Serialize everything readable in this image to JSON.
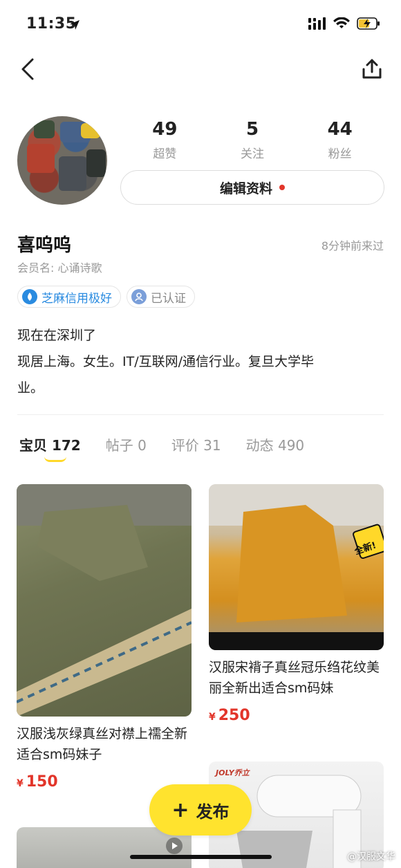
{
  "status": {
    "time": "11:35"
  },
  "profile": {
    "stats": [
      {
        "num": "49",
        "label": "超赞"
      },
      {
        "num": "5",
        "label": "关注"
      },
      {
        "num": "44",
        "label": "粉丝"
      }
    ],
    "edit_label": "编辑资料",
    "name": "喜呜呜",
    "last_seen": "8分钟前来过",
    "member": "会员名: 心诵诗歌",
    "badges": {
      "credit": "芝麻信用极好",
      "verified": "已认证"
    },
    "bio": [
      "现在在深圳了",
      "现居上海。女生。IT/互联网/通信行业。复旦大学毕",
      "业。"
    ]
  },
  "tabs": [
    {
      "label": "宝贝",
      "count": "172"
    },
    {
      "label": "帖子",
      "count": "0"
    },
    {
      "label": "评价",
      "count": "31"
    },
    {
      "label": "动态",
      "count": "490"
    }
  ],
  "items": [
    {
      "title": "汉服浅灰绿真丝对襟上襦全新适合sm码妹子",
      "currency": "¥",
      "price": "150"
    },
    {
      "title": "汉服宋褙子真丝冠乐绉花纹美丽全新出适合sm码妹",
      "currency": "¥",
      "price": "250"
    }
  ],
  "image_texts": {
    "new_sticker": "全新!",
    "mixer_brand": "JOLY乔立"
  },
  "fab_label": "发布",
  "watermark": "@汉服文华",
  "colors": {
    "accent_yellow": "#ffe32e",
    "price_red": "#e2352a",
    "credit_blue": "#2a8be0"
  }
}
